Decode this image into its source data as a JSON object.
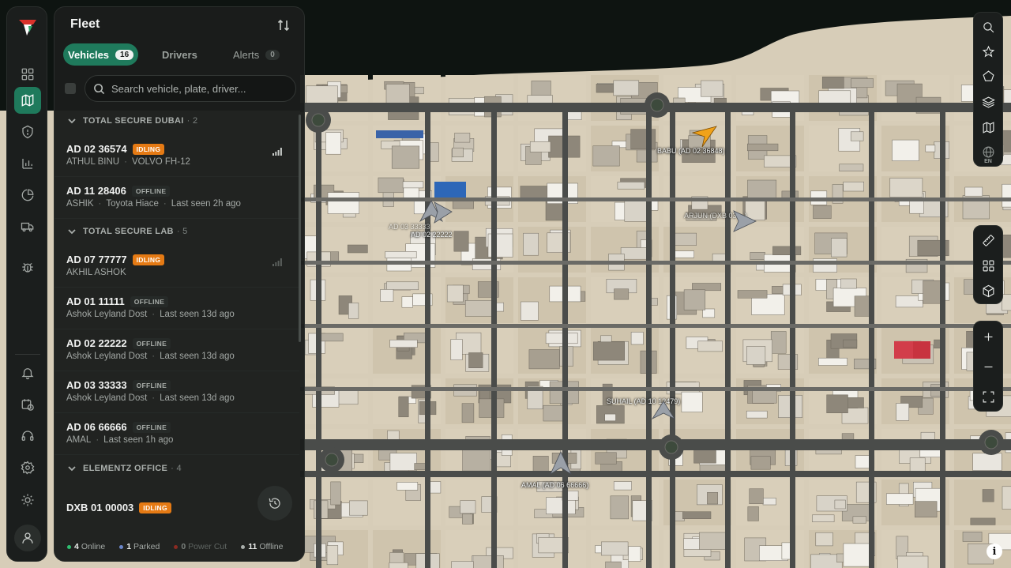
{
  "rail": {
    "items": [
      {
        "name": "dashboard-icon"
      },
      {
        "name": "map-icon",
        "active": true
      },
      {
        "name": "shield-icon"
      },
      {
        "name": "bar-chart-icon"
      },
      {
        "name": "pie-chart-icon"
      },
      {
        "name": "truck-icon"
      },
      {
        "name": "bug-icon"
      },
      {
        "name": "bell-icon"
      },
      {
        "name": "calendar-clock-icon"
      },
      {
        "name": "headset-icon"
      },
      {
        "name": "gear-icon"
      },
      {
        "name": "sun-icon"
      },
      {
        "name": "user-icon"
      }
    ],
    "accent": "#1f7a5c"
  },
  "panel": {
    "title": "Fleet",
    "tabs": [
      {
        "label": "Vehicles",
        "count": "16",
        "active": true
      },
      {
        "label": "Drivers"
      },
      {
        "label": "Alerts",
        "count": "0"
      }
    ],
    "search": {
      "placeholder": "Search vehicle, plate, driver..."
    },
    "groups": [
      {
        "name": "TOTAL SECURE DUBAI",
        "count": "· 2",
        "vehicles": [
          {
            "plate": "AD 02 36574",
            "status": "IDLING",
            "driver": "ATHUL BINU",
            "model": "VOLVO FH-12",
            "seen": ""
          },
          {
            "plate": "AD 11 28406",
            "status": "OFFLINE",
            "driver": "ASHIK",
            "model": "Toyota Hiace",
            "seen": "Last seen 2h ago"
          }
        ]
      },
      {
        "name": "TOTAL SECURE LAB",
        "count": "· 5",
        "vehicles": [
          {
            "plate": "AD 07 77777",
            "status": "IDLING",
            "driver": "AKHIL ASHOK",
            "model": "",
            "seen": ""
          },
          {
            "plate": "AD 01 11111",
            "status": "OFFLINE",
            "driver": "",
            "model": "Ashok Leyland Dost",
            "seen": "Last seen 13d ago"
          },
          {
            "plate": "AD 02 22222",
            "status": "OFFLINE",
            "driver": "",
            "model": "Ashok Leyland Dost",
            "seen": "Last seen 13d ago"
          },
          {
            "plate": "AD 03 33333",
            "status": "OFFLINE",
            "driver": "",
            "model": "Ashok Leyland Dost",
            "seen": "Last seen 13d ago"
          },
          {
            "plate": "AD 06 66666",
            "status": "OFFLINE",
            "driver": "AMAL",
            "model": "",
            "seen": "Last seen 1h ago"
          }
        ]
      },
      {
        "name": "ELEMENTZ OFFICE",
        "count": "· 4",
        "vehicles": [
          {
            "plate": "DXB 01 00003",
            "status": "IDLING",
            "driver": "",
            "model": "",
            "seen": ""
          }
        ]
      }
    ],
    "footer": {
      "online": {
        "count": "4",
        "label": "Online",
        "color": "#2fbf71"
      },
      "parked": {
        "count": "1",
        "label": "Parked",
        "color": "#6b86c9"
      },
      "power_cut": {
        "count": "0",
        "label": "Power Cut",
        "color": "#c0392b"
      },
      "offline": {
        "count": "11",
        "label": "Offline",
        "color": "#a9aeab"
      }
    }
  },
  "map": {
    "labels": [
      "BABU (AD 02 36848)",
      "AD 02 22222",
      "AD 03 33333",
      "SUHAIL (AD 10 12479)",
      "AMAL (AD 06 66666)",
      "ARJUN (DXB 03 ...)"
    ]
  },
  "right_tools": {
    "group1": [
      "search-icon",
      "star-icon",
      "pentagon-icon",
      "layers-icon",
      "map-icon",
      "globe-icon"
    ],
    "lang": "EN",
    "group2": [
      "ruler-icon",
      "grid-icon",
      "cube-icon"
    ],
    "group3": [
      "zoom-in-icon",
      "zoom-out-icon",
      "fullscreen-icon"
    ],
    "info": "i"
  },
  "colors": {
    "idling": "#e57a14",
    "accent": "#1f7a5c"
  }
}
